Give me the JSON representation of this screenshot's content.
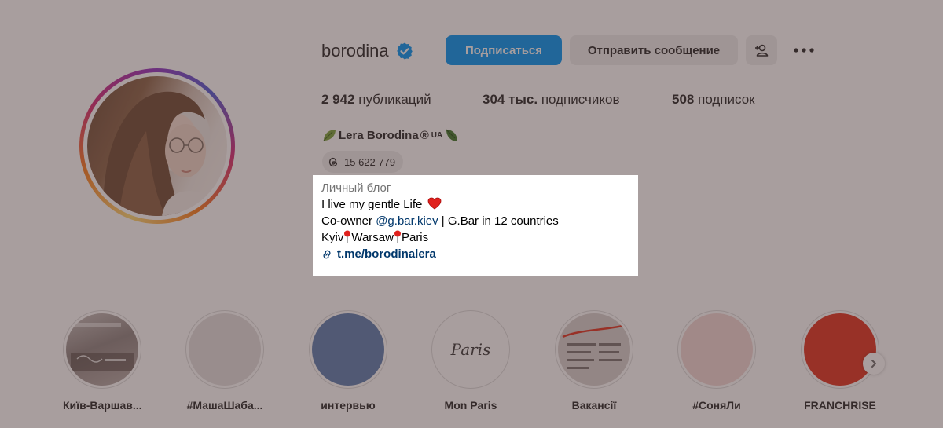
{
  "profile": {
    "username": "borodina",
    "follow_label": "Подписаться",
    "message_label": "Отправить сообщение",
    "full_name": "Lera Borodina",
    "full_name_mark": "®",
    "full_name_suffix": "UA",
    "threads_count": "15 622 779"
  },
  "stats": {
    "posts_value": "2 942",
    "posts_label": "публикаций",
    "followers_value": "304 тыс.",
    "followers_label": "подписчиков",
    "following_value": "508",
    "following_label": "подписок"
  },
  "bio": {
    "category": "Личный блог",
    "line1": "I live my gentle Life",
    "line2_prefix": "Co-owner ",
    "line2_mention": "@g.bar.kiev",
    "line2_suffix": " | G.Bar in 12 countries",
    "city1": "Kyiv",
    "city2": "Warsaw",
    "city3": "Paris",
    "link": "t.me/borodinalera"
  },
  "highlights": [
    {
      "label": "Київ-Варшав..."
    },
    {
      "label": "#МашаШаба..."
    },
    {
      "label": "интервью"
    },
    {
      "label": "Mon Paris",
      "cover_text": "Paris"
    },
    {
      "label": "Вакансії"
    },
    {
      "label": "#СоняЛи"
    },
    {
      "label": "FRANCHRISE"
    }
  ],
  "colors": {
    "accent": "#0095f6",
    "link": "#00376b",
    "overlay": "rgba(70,48,48,0.47)",
    "highlight_interview": "#5b7eb0",
    "highlight_franchrise": "#e0321f",
    "highlight_sonya": "#f2d8d6"
  },
  "icons": [
    "verified-badge-icon",
    "add-user-icon",
    "more-options-icon",
    "threads-icon",
    "link-icon",
    "heart-icon",
    "pin-icon",
    "leaf-icon",
    "chevron-right-icon"
  ]
}
